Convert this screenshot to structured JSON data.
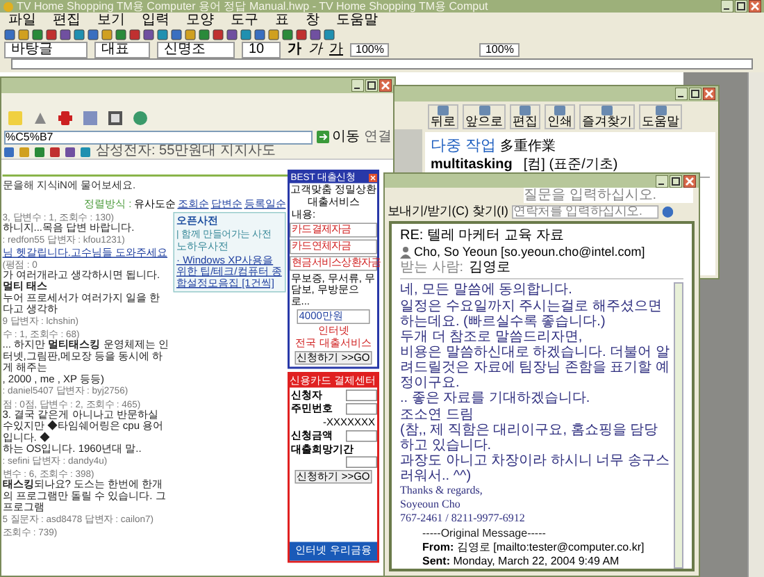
{
  "editor": {
    "title": "TV Home Shopping TM용 Computer 용어 정답 Manual.hwp - TV Home Shopping TM용 Comput",
    "menu": [
      "파일",
      "편집",
      "보기",
      "입력",
      "모양",
      "도구",
      "표",
      "창",
      "도움말"
    ],
    "style": "바탕글",
    "style2": "대표",
    "font": "신명조",
    "size": "10",
    "format_buttons": [
      "가",
      "가",
      "가"
    ],
    "zoom": "100%",
    "zoom2": "100%"
  },
  "browser": {
    "address": "%C5%B7",
    "go": "이동",
    "links": "연결",
    "link_bar": "삼성전자: 55만원대 지지사도",
    "banner": "문을해 지식iN에 물어보세요.",
    "sort_label": "정렬방식 : ",
    "sort_options": [
      {
        "label": "유사도순",
        "selected": true
      },
      {
        "label": "조회순",
        "selected": false
      },
      {
        "label": "답변순",
        "selected": false
      },
      {
        "label": "등록일순",
        "selected": false
      }
    ],
    "results": [
      {
        "lines": [
          {
            "kind": "meta",
            "text": "3, 답변수 : 1, 조회수 : 130)"
          },
          {
            "kind": "body",
            "text": "하니지...목음 답변 바랍니다."
          },
          {
            "kind": "meta",
            "text": ": redfon55 답변자 : kfou1231)"
          }
        ]
      },
      {
        "lines": [
          {
            "kind": "link",
            "text": "님 헷갈립니다.고수님들 도와주세요"
          },
          {
            "kind": "meta",
            "text": "(평점 : 0"
          },
          {
            "kind": "body",
            "text": "가 여러개라고 생각하시면 됩니다. **멀티 태스**"
          },
          {
            "kind": "body",
            "text": "누어 프로세서가 여러가지 일을 한다고 생각하"
          },
          {
            "kind": "meta",
            "text": "9 답변자 : lchshin)"
          }
        ]
      },
      {
        "lines": [
          {
            "kind": "meta",
            "text": "수 : 1, 조회수 : 68)"
          },
          {
            "kind": "body",
            "text": "... 하지만 **멀티태스킹** 운영체제는 인터넷,그림판,메모장 등을 동시에 하게 해주는"
          },
          {
            "kind": "body",
            "text": ", 2000 , me , XP 등등)"
          },
          {
            "kind": "meta",
            "text": ": daniel5407 답변자 : byj2756)"
          }
        ]
      },
      {
        "lines": [
          {
            "kind": "meta",
            "text": "점 : 0점, 답변수 : 2, 조회수 : 465)"
          },
          {
            "kind": "body",
            "text": "3. 결국 같은게 아니나고 반문하실 수있지만 ◆타임쉐어링은 cpu 용어입니다. ◆"
          },
          {
            "kind": "body",
            "text": "하는 OS입니다. 1960년대 말.."
          },
          {
            "kind": "meta",
            "text": ": sefini 답변자 : dandy4u)"
          }
        ]
      },
      {
        "lines": [
          {
            "kind": "meta",
            "text": "변수 : 6, 조회수 : 398)"
          },
          {
            "kind": "body",
            "text": "**태스킹**되나요? 도스는 한번에 한개의 프로그램만 돌릴 수 있습니다. 그 프로그램"
          },
          {
            "kind": "meta",
            "text": "5 질문자 : asd8478 답변자 : cailon7)"
          }
        ]
      },
      {
        "lines": [
          {
            "kind": "meta",
            "text": "조회수 : 739)"
          }
        ]
      }
    ],
    "side_box": {
      "title": "오픈사전",
      "subtitle": "| 함께 만들어가는 사전",
      "item": "노하우사전",
      "link": "· Windows XP사용을 위한 팁/테크/컴퓨터 종합설정모음집 [1건씩]"
    }
  },
  "loan_ad": {
    "title": "BEST 대출신청",
    "intro": "고객맞춤 정밀상환",
    "service": "대출서비스",
    "content_label": "내용:",
    "selects": [
      "카드결제자금",
      "카드연체자금",
      "현금서비스상환자금"
    ],
    "note": "무보증, 무서류, 무담보, 무방문으로...",
    "amount": "4000만원",
    "slogan1": "인터넷",
    "slogan2": "전국 대출서비스",
    "button": "신청하기 >>GO"
  },
  "card_ad": {
    "title": "신용카드 결제센터",
    "fields": [
      {
        "label": "신청자"
      },
      {
        "label": "주민번호",
        "hint": "-XXXXXXX"
      },
      {
        "label": "신청금액"
      },
      {
        "label": "대출희망기간"
      }
    ],
    "button": "신청하기 >>GO",
    "footer": "인터넷 우리금융"
  },
  "dictionary": {
    "toolbar": [
      "뒤로",
      "앞으로",
      "편집",
      "인쇄",
      "즐겨찾기",
      "도움말"
    ],
    "headword": "다중 작업",
    "hanja": "多重作業",
    "english": "multitasking",
    "tags": "[컴] (표준/기초)"
  },
  "email": {
    "question_placeholder": "질문을 입력하십시오.",
    "send_receive": "보내기/받기(C)",
    "find": "찾기(I)",
    "contact_placeholder": "연락처를 입력하십시오.",
    "subject": "RE: 텔레 마케터 교육 자료",
    "from": "Cho, So Yeoun [so.yeoun.cho@intel.com]",
    "to_label": "받는 사람:",
    "to": "김영로",
    "body": [
      {
        "kind": "text",
        "text": "네, 모든 말씀에 동의합니다."
      },
      {
        "kind": "gap"
      },
      {
        "kind": "text",
        "text": "일정은 수요일까지 주시는걸로 해주셨으면 하는데요. (빠르실수록 좋습니다.)"
      },
      {
        "kind": "text",
        "text": "두개 더 참조로 말씀드리자면,"
      },
      {
        "kind": "text",
        "text": "비용은 말씀하신대로 하겠습니다. 더불어 알려드릴것은 자료에 팀장님 존함을 표기할 예정이구요."
      },
      {
        "kind": "text",
        "text": ".. 좋은 자료를 기대하겠습니다."
      },
      {
        "kind": "gap"
      },
      {
        "kind": "text",
        "text": "조소연 드림"
      },
      {
        "kind": "text",
        "text": "(참,, 제 직함은 대리이구요, 홈쇼핑을 담당하고 있습니다."
      },
      {
        "kind": "text",
        "text": "과장도 아니고 차장이라 하시니 너무 송구스러워서.. ^^)"
      },
      {
        "kind": "gap"
      },
      {
        "kind": "serif",
        "text": "Thanks & regards,"
      },
      {
        "kind": "serif",
        "text": "Soyeoun Cho"
      },
      {
        "kind": "serif",
        "text": "767-2461 / 8211-9977-6912"
      },
      {
        "kind": "gap"
      }
    ],
    "original_header": "-----Original Message-----",
    "original": [
      {
        "label": "From:",
        "value": "김영로 [mailto:tester@computer.co.kr]"
      },
      {
        "label": "Sent:",
        "value": "Monday, March 22, 2004 9:49 AM"
      }
    ]
  }
}
